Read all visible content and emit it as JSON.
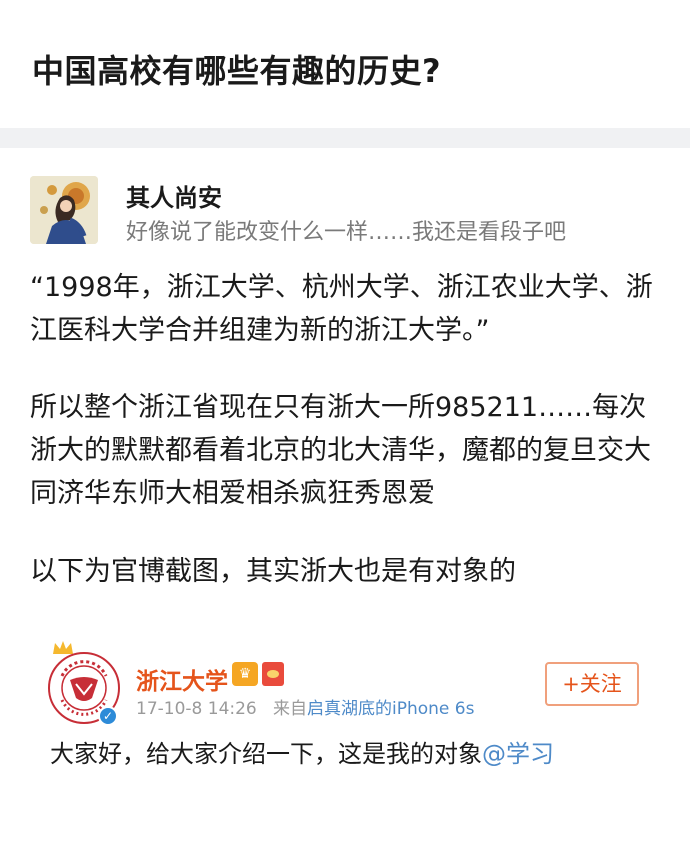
{
  "question": {
    "title": "中国高校有哪些有趣的历史?"
  },
  "answer": {
    "author": {
      "name": "其人尚安",
      "bio": "好像说了能改变什么一样……我还是看段子吧"
    },
    "paragraphs": [
      "“1998年，浙江大学、杭州大学、浙江农业大学、浙江医科大学合并组建为新的浙江大学。”",
      "所以整个浙江省现在只有浙大一所985211……每次浙大的默默都看着北京的北大清华，魔都的复旦交大同济华东师大相爱相杀疯狂秀恩爱",
      "以下为官博截图，其实浙大也是有对象的"
    ]
  },
  "weibo": {
    "user": "浙江大学",
    "timestamp": "17-10-8 14:26",
    "source_prefix": "来自",
    "source": "启真湖底的iPhone 6s",
    "follow_label": "+关注",
    "text": "大家好，给大家介绍一下，这是我的对象",
    "mention": "@学习",
    "colors": {
      "name": "#e5541b",
      "link": "#4e8ac8",
      "follow": "#e5541b"
    }
  }
}
